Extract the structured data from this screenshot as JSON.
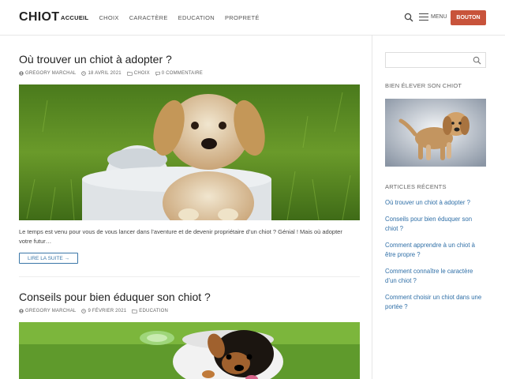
{
  "header": {
    "brand": "CHIOT",
    "nav": [
      "ACCUEIL",
      "CHOIX",
      "CARACTÈRE",
      "EDUCATION",
      "PROPRETÉ"
    ],
    "menu_label": "MENU",
    "cta_label": "BOUTON",
    "cta_color": "#c8533b",
    "icons": {
      "search": "search-icon",
      "menu": "hamburger-icon"
    }
  },
  "posts": [
    {
      "title": "Où trouver un chiot à adopter ?",
      "author": "GREGORY MARCHAL",
      "date": "18 AVRIL 2021",
      "category": "CHOIX",
      "comments": "0 COMMENTAIRE",
      "excerpt": "Le temps est venu pour vous de vous lancer dans l’aventure et de devenir propriétaire d’un chiot ? Génial ! Mais où adopter votre futur…",
      "read_more": "LIRE LA SUITE →"
    },
    {
      "title": "Conseils pour bien éduquer son chiot ?",
      "author": "GREGORY MARCHAL",
      "date": "9 FÉVRIER 2021",
      "category": "EDUCATION"
    }
  ],
  "sidebar": {
    "search_placeholder": "",
    "widget1_title": "BIEN ÉLEVER SON CHIOT",
    "widget2_title": "ARTICLES RÉCENTS",
    "recent": [
      "Où trouver un chiot à adopter ?",
      "Conseils pour bien éduquer son chiot ?",
      "Comment apprendre à un chiot à être propre ?",
      "Comment connaître le caractère d’un chiot ?",
      "Comment choisir un chiot dans une portée ?"
    ]
  },
  "colors": {
    "link": "#2f6fa7",
    "accent": "#c8533b"
  }
}
